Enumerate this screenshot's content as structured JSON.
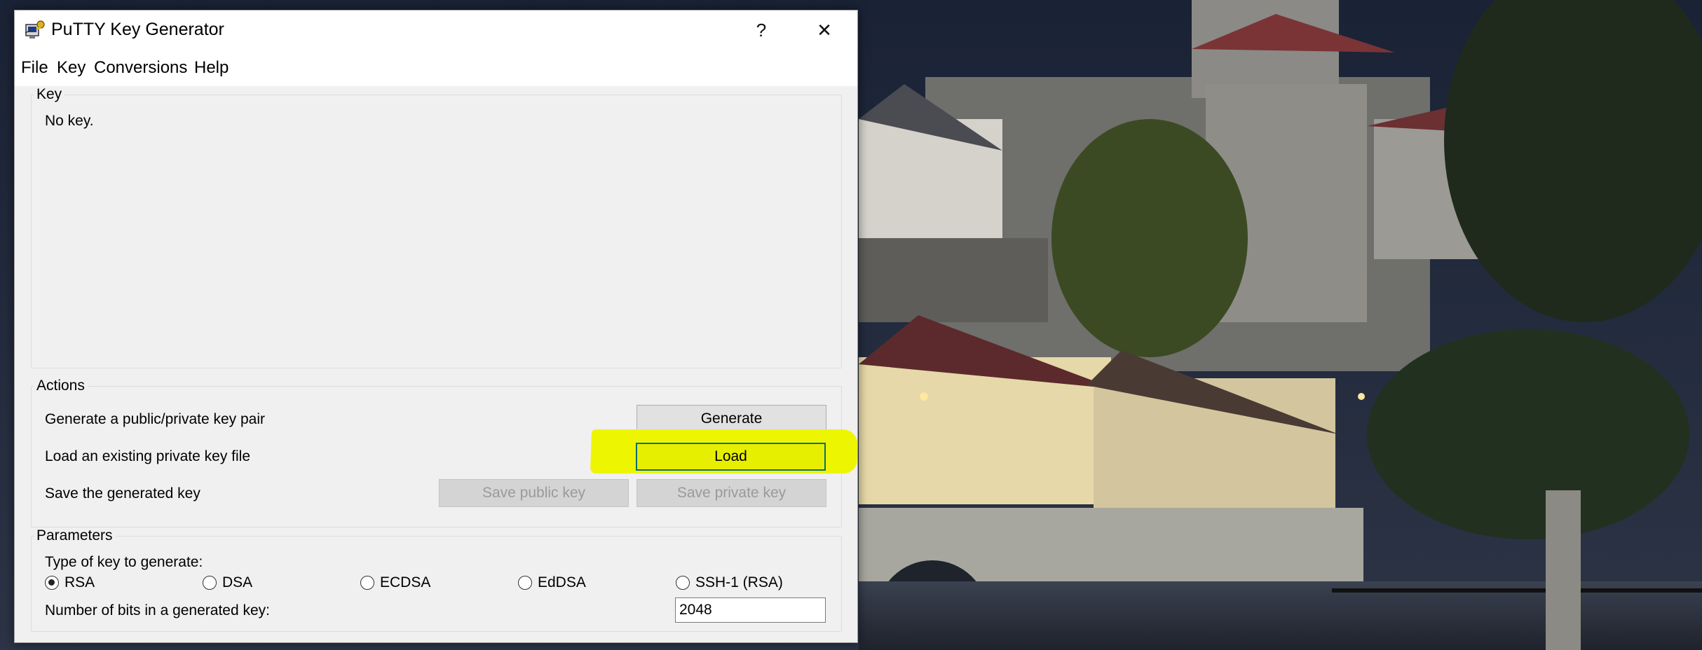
{
  "window": {
    "title": "PuTTY Key Generator",
    "help_glyph": "?",
    "close_glyph": "✕"
  },
  "menu": [
    "File",
    "Key",
    "Conversions",
    "Help"
  ],
  "key_group": {
    "label": "Key",
    "status": "No key."
  },
  "actions_group": {
    "label": "Actions",
    "generate_desc": "Generate a public/private key pair",
    "generate_button": "Generate",
    "load_desc": "Load an existing private key file",
    "load_button": "Load",
    "save_desc": "Save the generated key",
    "save_public_button": "Save public key",
    "save_private_button": "Save private key"
  },
  "parameters_group": {
    "label": "Parameters",
    "type_label": "Type of key to generate:",
    "key_types": [
      {
        "label": "RSA",
        "checked": true
      },
      {
        "label": "DSA",
        "checked": false
      },
      {
        "label": "ECDSA",
        "checked": false
      },
      {
        "label": "EdDSA",
        "checked": false
      },
      {
        "label": "SSH-1 (RSA)",
        "checked": false
      }
    ],
    "bits_label": "Number of bits in a generated key:",
    "bits_value": "2048"
  },
  "colors": {
    "highlight": "#eef500",
    "focus_border": "#0d6e73"
  },
  "icons": [
    "putty-keygen-icon",
    "help-icon",
    "close-icon"
  ]
}
